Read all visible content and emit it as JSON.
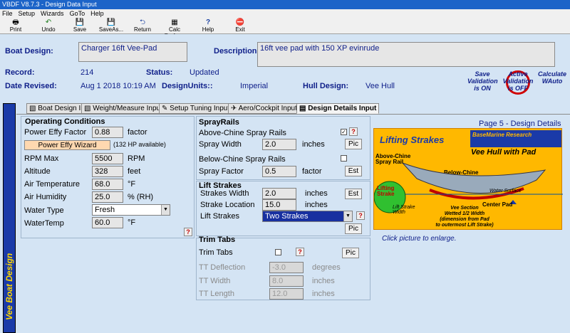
{
  "window": {
    "title": "VBDF V8.7.3 - Design Data Input"
  },
  "menu": [
    "File",
    "Setup",
    "Wizards",
    "GoTo",
    "Help"
  ],
  "toolbar": [
    {
      "label": "Print",
      "icon": "printer-icon",
      "glyph": "🖶"
    },
    {
      "label": "Undo",
      "icon": "undo-icon",
      "glyph": "↶"
    },
    {
      "label": "Save",
      "icon": "save-icon",
      "glyph": "💾"
    },
    {
      "label": "SaveAs...",
      "icon": "save-as-icon",
      "glyph": "💾"
    },
    {
      "label": "Return",
      "icon": "return-icon",
      "glyph": "⮌"
    },
    {
      "label": "Calc Perform",
      "icon": "calculator-icon",
      "glyph": "▦"
    },
    {
      "label": "Help",
      "icon": "help-icon",
      "glyph": "?"
    },
    {
      "label": "Exit",
      "icon": "exit-icon",
      "glyph": "⛔"
    }
  ],
  "header": {
    "boat_design_label": "Boat Design:",
    "boat_design_value": "Charger 16ft Vee-Pad",
    "description_label": "Description:",
    "description_value": "16ft vee pad with 150 XP evinrude",
    "record_label": "Record:",
    "record_value": "214",
    "status_label": "Status:",
    "status_value": "Updated",
    "date_label": "Date Revised:",
    "date_value": "Aug 1 2018 10:19 AM",
    "units_label": "DesignUnits::",
    "units_value": "Imperial",
    "hull_label": "Hull Design:",
    "hull_value": "Vee Hull",
    "badge_save_validation": "Save\nValidation\nis ON",
    "badge_active_validation": "Active\nValidation\nis OFF",
    "badge_calculate": "Calculate\nWAuto"
  },
  "tabs": [
    "Boat Design Input",
    "Weight/Measure Input",
    "Setup Tuning Input",
    "Aero/Cockpit Input",
    "Design Details Input"
  ],
  "side_title": "Vee Boat Design",
  "page_label": "Page 5 - Design Details",
  "operating": {
    "title": "Operating Conditions",
    "power_effy_label": "Power Effy Factor",
    "power_effy_value": "0.88",
    "power_effy_unit": "factor",
    "wizard_button": "Power Effy Wizard",
    "hp_available": "(132 HP available)",
    "rpm_label": "RPM Max",
    "rpm_value": "5500",
    "rpm_unit": "RPM",
    "alt_label": "Altitude",
    "alt_value": "328",
    "alt_unit": "feet",
    "temp_label": "Air Temperature",
    "temp_value": "68.0",
    "temp_unit": "°F",
    "hum_label": "Air Humidity",
    "hum_value": "25.0",
    "hum_unit": "% (RH)",
    "water_type_label": "Water Type",
    "water_type_value": "Fresh",
    "water_temp_label": "WaterTemp",
    "water_temp_value": "60.0",
    "water_temp_unit": "°F",
    "help_q": "?"
  },
  "spray": {
    "title": "SprayRails",
    "above_label": "Above-Chine Spray Rails",
    "above_checked": "✓",
    "help_q": "?",
    "width_label": "Spray Width",
    "width_value": "2.0",
    "width_unit": "inches",
    "pic_button": "Pic",
    "below_label": "Below-Chine Spray Rails",
    "factor_label": "Spray Factor",
    "factor_value": "0.5",
    "factor_unit": "factor",
    "est_button": "Est"
  },
  "lift": {
    "title": "Lift Strakes",
    "width_label": "Strakes Width",
    "width_value": "2.0",
    "width_unit": "inches",
    "loc_label": "Strake Location",
    "loc_value": "15.0",
    "loc_unit": "inches",
    "est_button": "Est",
    "strakes_label": "Lift Strakes",
    "strakes_value": "Two Strakes",
    "help_q": "?",
    "pic_button": "Pic"
  },
  "trim": {
    "title": "Trim Tabs",
    "tabs_label": "Trim Tabs",
    "help_q": "?",
    "pic_button": "Pic",
    "defl_label": "TT Deflection",
    "defl_value": "-3.0",
    "defl_unit": "degrees",
    "width_label": "TT Width",
    "width_value": "8.0",
    "width_unit": "inches",
    "len_label": "TT Length",
    "len_value": "12.0",
    "len_unit": "inches"
  },
  "picture": {
    "title": "Lifting Strakes",
    "brand": "BaseMarine Research",
    "hull": "Vee Hull with Pad",
    "above": "Above-Chine\nSpray Rail",
    "below": "Below-Chine\nSpray Rail",
    "lifting": "Lifting\nStrake",
    "strake_width": "Lift Strake\nWidth",
    "water": "Water Surface",
    "pad": "Center Pad",
    "vee": "Vee Section\nWetted 1/2 Width\n(dimension from Pad\nto outermost Lift Strake)",
    "caption": "Click picture to enlarge."
  }
}
